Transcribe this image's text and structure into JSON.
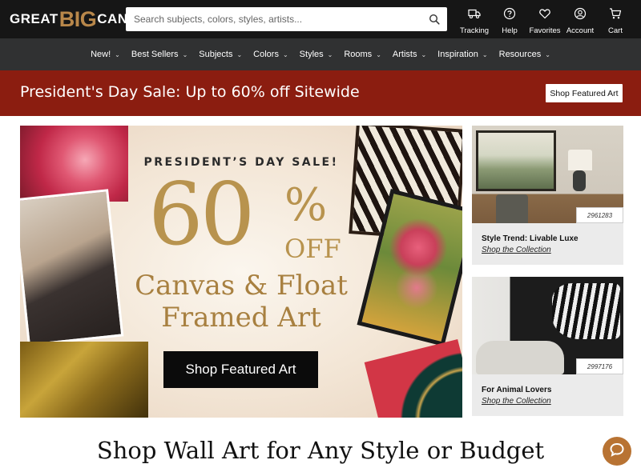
{
  "header": {
    "logo": {
      "word1": "GREAT",
      "word2": "BIG",
      "word3": "CANVAS",
      "mark": "."
    },
    "search": {
      "placeholder": "Search subjects, colors, styles, artists...",
      "value": "",
      "icon": "search-icon"
    },
    "utilities": [
      {
        "label": "Tracking",
        "icon": "truck-icon"
      },
      {
        "label": "Help",
        "icon": "question-icon"
      },
      {
        "label": "Favorites",
        "icon": "heart-icon"
      },
      {
        "label": "Account",
        "icon": "user-icon"
      },
      {
        "label": "Cart",
        "icon": "cart-icon"
      }
    ]
  },
  "nav": {
    "items": [
      "New!",
      "Best Sellers",
      "Subjects",
      "Colors",
      "Styles",
      "Rooms",
      "Artists",
      "Inspiration",
      "Resources"
    ],
    "chevron": "chevron-down-icon"
  },
  "sale_banner": {
    "text": "President's Day Sale: Up to 60% off Sitewide",
    "button": "Shop Featured Art",
    "background": "#8b1d10"
  },
  "hero": {
    "kicker": "PRESIDENT’S DAY SALE!",
    "big_number": "60",
    "percent": "%",
    "off": "OFF",
    "line1": "Canvas & Float",
    "line2": "Framed Art",
    "button": "Shop Featured Art",
    "accent": "#b8934e"
  },
  "cards": [
    {
      "id": "2961283",
      "title": "Style Trend: Livable Luxe",
      "link": "Shop the Collection"
    },
    {
      "id": "2997176",
      "title": "For Animal Lovers",
      "link": "Shop the Collection"
    }
  ],
  "section_title": "Shop Wall Art for Any Style or Budget",
  "chat": {
    "icon": "chat-bubble-icon",
    "color": "#b87333"
  }
}
